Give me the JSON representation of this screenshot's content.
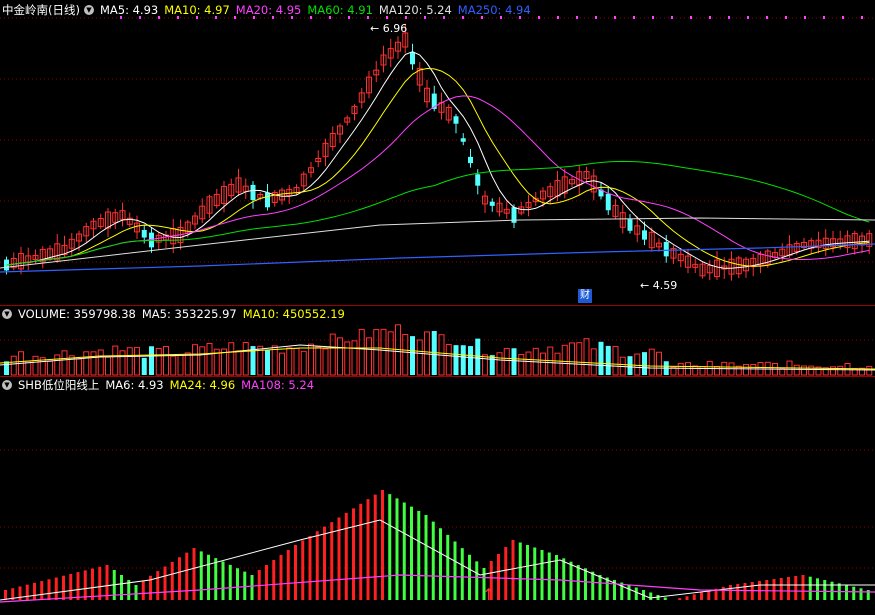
{
  "price_panel": {
    "symbol": "中金岭南(日线)",
    "ma": [
      {
        "label": "MA5: 4.93",
        "color": "#ffffff"
      },
      {
        "label": "MA10: 4.97",
        "color": "#ffff00"
      },
      {
        "label": "MA20: 4.95",
        "color": "#ff40ff"
      },
      {
        "label": "MA60: 4.91",
        "color": "#00e000"
      },
      {
        "label": "MA120: 5.24",
        "color": "#e0e0e0"
      },
      {
        "label": "MA250: 4.94",
        "color": "#3060ff"
      }
    ],
    "high_label": "6.96",
    "low_label": "4.59",
    "badge": "财"
  },
  "volume_panel": {
    "title": "VOLUME: 359798.38",
    "ma5": "MA5: 353225.97",
    "ma10": "MA10: 450552.19",
    "colors": {
      "title": "#ffffff",
      "ma5": "#ffffff",
      "ma10": "#ffff00"
    }
  },
  "indicator_panel": {
    "title": "SHB低位阳线上",
    "ma6": "MA6: 4.93",
    "ma24": "MA24: 4.96",
    "ma108": "MA108: 5.24",
    "colors": {
      "title": "#ffffff",
      "ma6": "#ffffff",
      "ma24": "#ffff00",
      "ma108": "#ff40ff"
    }
  },
  "colors": {
    "up": "#ff3030",
    "down": "#54ffff",
    "grid": "#8b0000",
    "ind_up": "#ff2020",
    "ind_down": "#40ff40"
  }
}
